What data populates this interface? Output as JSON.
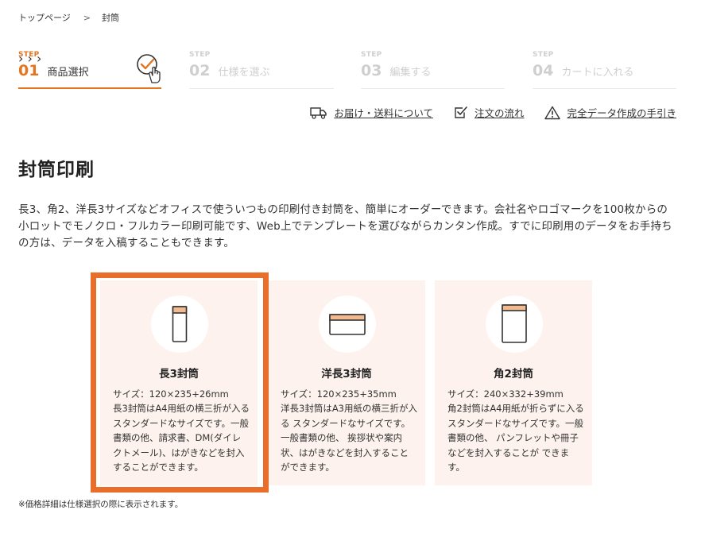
{
  "breadcrumb": {
    "items": [
      "トップページ",
      "封筒"
    ],
    "separator": ">"
  },
  "steps": [
    {
      "label": "STEP",
      "num": "01",
      "name": "商品選択",
      "state": "active"
    },
    {
      "label": "STEP",
      "num": "02",
      "name": "仕様を選ぶ",
      "state": "inactive"
    },
    {
      "label": "STEP",
      "num": "03",
      "name": "編集する",
      "state": "inactive"
    },
    {
      "label": "STEP",
      "num": "04",
      "name": "カートに入れる",
      "state": "inactive"
    }
  ],
  "links": [
    {
      "label": "お届け・送料について",
      "icon": "truck-icon"
    },
    {
      "label": "注文の流れ",
      "icon": "checkbox-icon"
    },
    {
      "label": "完全データ作成の手引き",
      "icon": "warning-icon"
    }
  ],
  "page_title": "封筒印刷",
  "description": "長3、角2、洋長3サイズなどオフィスで使ういつもの印刷付き封筒を、簡単にオーダーできます。会社名やロゴマークを100枚からの小ロットでモノクロ・フルカラー印刷可能です、Web上でテンプレートを選びながらカンタン作成。すでに印刷用のデータをお手持ちの方は、データを入稿することもできます。",
  "products": [
    {
      "name": "長3封筒",
      "size": "サイズ：120×235+26mm",
      "text": "長3封筒はA4用紙の横三折が入るスタンダードなサイズです。一般書類の他、請求書、DM(ダイレクトメール)、はがきなどを封入することができます。",
      "selected": true,
      "icon": "envelope-vertical-icon"
    },
    {
      "name": "洋長3封筒",
      "size": "サイズ：120×235+35mm",
      "text": "洋長3封筒はA3用紙の横三折が入る スタンダードなサイズです。一般書類の他、 挨拶状や案内状、はがきなどを封入することができます。",
      "selected": false,
      "icon": "envelope-horizontal-icon"
    },
    {
      "name": "角2封筒",
      "size": "サイズ：240×332+39mm",
      "text": "角2封筒はA4用紙が折らずに入る スタンダードなサイズです。一般書類の他、 パンフレットや冊子などを封入することが できます。",
      "selected": false,
      "icon": "envelope-large-icon"
    }
  ],
  "note": "※価格詳細は仕様選択の際に表示されます。",
  "colors": {
    "accent": "#e4741f",
    "frame": "#e86e2a",
    "card_bg": "#fdf2ed",
    "envelope_flap": "#f3b98f"
  }
}
